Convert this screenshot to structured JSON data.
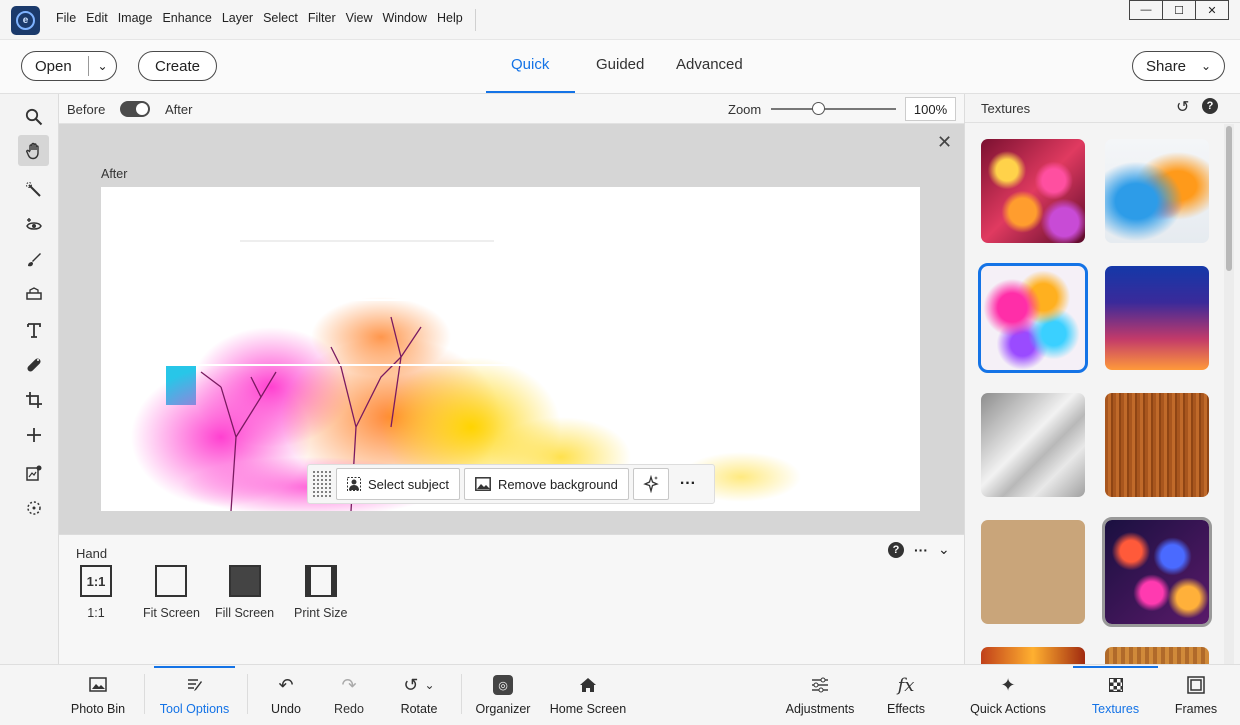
{
  "menubar": {
    "items": [
      "File",
      "Edit",
      "Image",
      "Enhance",
      "Layer",
      "Select",
      "Filter",
      "View",
      "Window",
      "Help"
    ],
    "window_controls": [
      "—",
      "☐",
      "✕"
    ]
  },
  "modebar": {
    "open_label": "Open",
    "create_label": "Create",
    "share_label": "Share",
    "tabs": [
      "Quick",
      "Guided",
      "Advanced"
    ],
    "active_tab": "Quick"
  },
  "options_bar": {
    "before_label": "Before",
    "after_label": "After",
    "zoom_label": "Zoom",
    "zoom_value": "100%",
    "zoom_level": 0.38
  },
  "canvas": {
    "view_label": "After"
  },
  "context_bar": {
    "select_subject": "Select subject",
    "remove_background": "Remove background",
    "more": "···"
  },
  "tool_options": {
    "title": "Hand",
    "items": [
      {
        "label": "1:1",
        "glyph": "1:1"
      },
      {
        "label": "Fit Screen",
        "glyph": ""
      },
      {
        "label": "Fill Screen",
        "glyph": ""
      },
      {
        "label": "Print Size",
        "glyph": ""
      }
    ]
  },
  "side_panel": {
    "title": "Textures",
    "textures": [
      "bokeh-hearts",
      "watercolor-smoke",
      "paint-splash",
      "blue-orange-gradient",
      "light-leaks-grey",
      "wood-grain",
      "kraft-paper",
      "bokeh-colorful",
      "fire-bokeh",
      "wood-planks"
    ]
  },
  "taskbar": {
    "photo_bin": "Photo Bin",
    "tool_options": "Tool Options",
    "undo": "Undo",
    "redo": "Redo",
    "rotate": "Rotate",
    "organizer": "Organizer",
    "home_screen": "Home Screen",
    "adjustments": "Adjustments",
    "effects": "Effects",
    "quick_actions": "Quick Actions",
    "textures": "Textures",
    "frames": "Frames"
  },
  "colors": {
    "accent": "#1473e6"
  }
}
